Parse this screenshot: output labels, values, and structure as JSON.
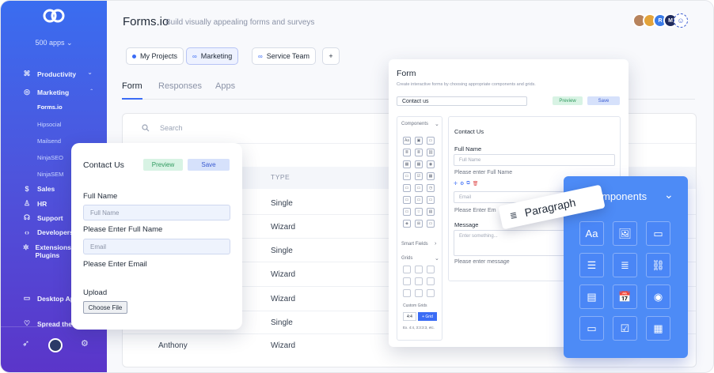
{
  "sidebar": {
    "apps_count": "500 apps",
    "items": [
      {
        "label": "Productivity",
        "icon": "command-icon"
      },
      {
        "label": "Marketing",
        "icon": "globe-icon"
      },
      {
        "label": "Sales",
        "icon": "dollar-icon"
      },
      {
        "label": "HR",
        "icon": "user-icon"
      },
      {
        "label": "Support",
        "icon": "headset-icon"
      },
      {
        "label": "Developers",
        "icon": "code-icon"
      },
      {
        "label": "Extensions & Plugins",
        "icon": "puzzle-icon"
      },
      {
        "label": "Desktop Ap",
        "icon": "monitor-icon"
      },
      {
        "label": "Spread the",
        "icon": "heart-icon"
      }
    ],
    "marketing_sub": [
      "Forms.io",
      "Hipsocial",
      "Mailsend",
      "NinjaSEO",
      "NinjaSEM"
    ],
    "expand_icon": "chevron-down-icon",
    "collapse_icon": "chevron-up-icon"
  },
  "header": {
    "title": "Forms.io",
    "subtitle": "Build visually appealing forms and surveys",
    "avatar_initials": [
      "R",
      "M"
    ]
  },
  "chips": [
    {
      "label": "My Projects",
      "selected": false
    },
    {
      "label": "Marketing",
      "selected": true
    },
    {
      "label": "Service Team",
      "selected": false
    }
  ],
  "add_chip": "+",
  "tabs": [
    "Form",
    "Responses",
    "Apps"
  ],
  "search_placeholder": "Search",
  "table": {
    "type_header": "TYPE",
    "types": [
      "Single",
      "Wizard",
      "Single",
      "Wizard",
      "Wizard",
      "Single",
      "Wizard"
    ],
    "last_name": "Anthony"
  },
  "contact_popup": {
    "title": "Contact Us",
    "preview": "Preview",
    "save": "Save",
    "full_name_label": "Full Name",
    "full_name_placeholder": "Full Name",
    "full_name_help": "Please Enter Full Name",
    "email_placeholder": "Email",
    "email_help": "Please Enter Email",
    "upload_label": "Upload",
    "choose_file": "Choose File"
  },
  "builder": {
    "title": "Form",
    "description": "Create interactive forms by choosing appropriate components and grids.",
    "form_name": "Contact us",
    "preview": "Preview",
    "save": "Save",
    "components_label": "Components",
    "smart_fields": "Smart Fields",
    "grids": "Grids",
    "custom_grids": "Custom Grids",
    "grid_value": "4:4",
    "add_grid": "+ Grid",
    "grid_hint": "Ex. 4:4, 3:3:3:3, etc.",
    "form_heading": "Contact Us",
    "full_name_label": "Full Name",
    "full_name_placeholder": "Full Name",
    "full_name_help": "Please enter Full Name",
    "email_placeholder": "Email",
    "email_help": "Please Enter Em",
    "message_label": "Message",
    "message_placeholder": "Enter something...",
    "message_help": "Please enter message"
  },
  "drag_chip": "Paragraph",
  "components_panel": {
    "title": "mponents",
    "tiles": [
      "text-icon",
      "image-icon",
      "input-icon",
      "list-icon",
      "paragraph-icon",
      "link-icon",
      "table-icon",
      "date-icon",
      "radio-icon",
      "button-icon",
      "checkbox-icon",
      "calendar-icon"
    ],
    "tile_text": "Aa"
  },
  "colors": {
    "accent": "#3b6cf5",
    "sidebar_top": "#3a6df0",
    "sidebar_bottom": "#5b35c9",
    "panel": "#4d8bf6"
  }
}
